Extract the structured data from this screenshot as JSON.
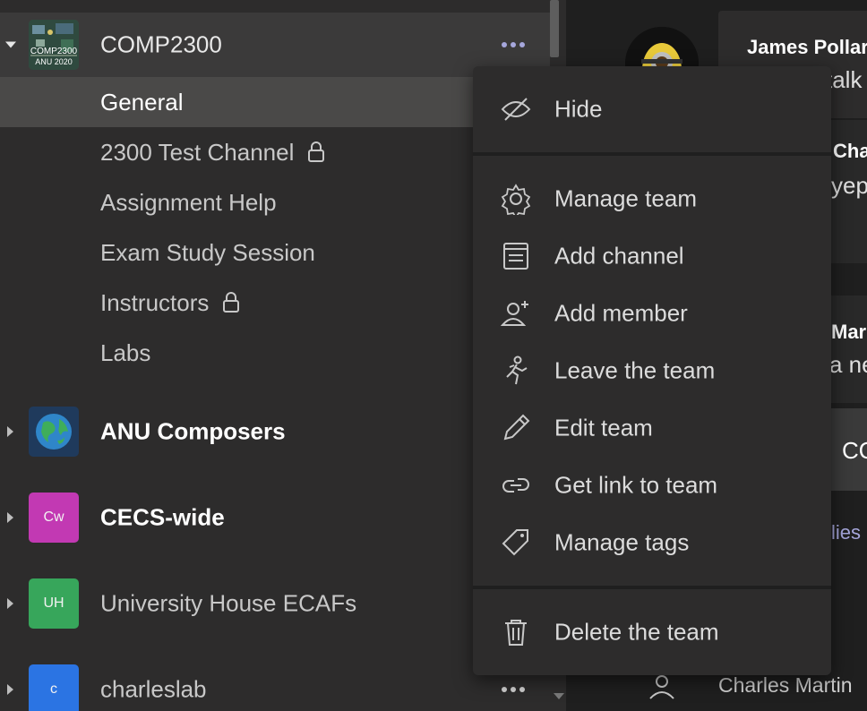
{
  "sidebar": {
    "teams": [
      {
        "name": "COMP2300",
        "avatar_text": "COMP2300\nANU 2020",
        "avatar_color": "#3a5a4a",
        "expanded": true,
        "channels": [
          {
            "label": "General",
            "locked": false,
            "selected": true
          },
          {
            "label": "2300 Test Channel",
            "locked": true,
            "selected": false
          },
          {
            "label": "Assignment Help",
            "locked": false,
            "selected": false
          },
          {
            "label": "Exam Study Session",
            "locked": false,
            "selected": false
          },
          {
            "label": "Instructors",
            "locked": true,
            "selected": false
          },
          {
            "label": "Labs",
            "locked": false,
            "selected": false
          }
        ]
      },
      {
        "name": "ANU Composers",
        "avatar_icon": "globe-icon",
        "avatar_color": "#1f3a5c",
        "bold": true
      },
      {
        "name": "CECS-wide",
        "avatar_text": "Cw",
        "avatar_color": "#c239b3",
        "bold": true
      },
      {
        "name": "University House ECAFs",
        "avatar_text": "UH",
        "avatar_color": "#37a65b",
        "bold": false
      },
      {
        "name": "charleslab",
        "avatar_text": "c",
        "avatar_color": "#2b74e3",
        "bold": false
      }
    ]
  },
  "context_menu": {
    "items": [
      {
        "label": "Hide",
        "icon": "hide-icon"
      },
      {
        "label": "Manage team",
        "icon": "gear-icon"
      },
      {
        "label": "Add channel",
        "icon": "add-channel-icon"
      },
      {
        "label": "Add member",
        "icon": "add-member-icon"
      },
      {
        "label": "Leave the team",
        "icon": "leave-icon"
      },
      {
        "label": "Edit team",
        "icon": "pencil-icon"
      },
      {
        "label": "Get link to team",
        "icon": "link-icon"
      },
      {
        "label": "Manage tags",
        "icon": "tag-icon"
      },
      {
        "label": "Delete the team",
        "icon": "trash-icon"
      }
    ]
  },
  "chat": {
    "msg1_author": "James Pollar",
    "msg1_text": "talk",
    "msg2_author": "Cha",
    "msg2_text": "yep",
    "msg3_author": "Mar",
    "msg3_text": "a ne",
    "card_text": "CO",
    "replies_text": "lies",
    "footer_author": "Charles Martin"
  },
  "colors": {
    "sidebar_bg": "#2d2c2c",
    "selected_bg": "#4a4948",
    "accent": "#a6a7dc",
    "menu_bg": "#2d2c2c"
  }
}
